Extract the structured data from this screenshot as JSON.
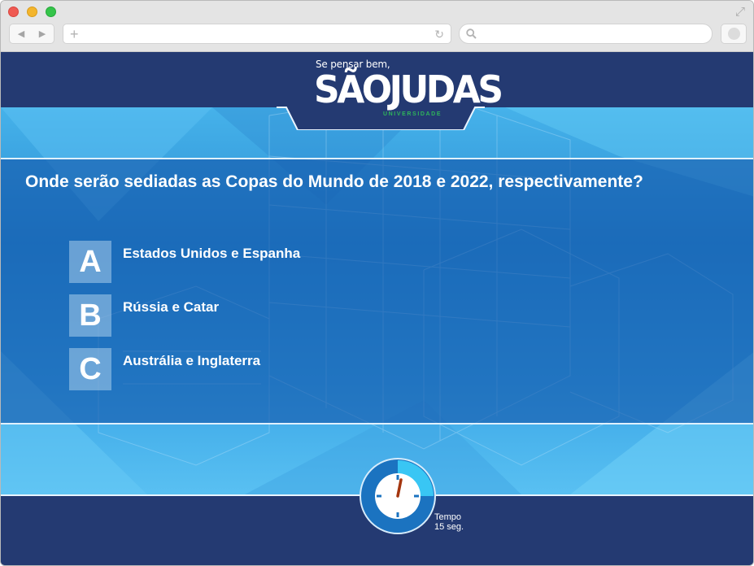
{
  "browser": {
    "nav_back": "◀",
    "nav_forward": "▶",
    "new_tab": "+",
    "reload": "↻",
    "expand": "⤢"
  },
  "brand": {
    "tagline": "Se pensar bem,",
    "name": "SÃOJUDAS",
    "subtitle": "UNIVERSIDADE"
  },
  "quiz": {
    "question": "Onde serão sediadas as Copas do Mundo de 2018 e 2022, respectivamente?",
    "options": [
      {
        "letter": "A",
        "text": "Estados Unidos e Espanha"
      },
      {
        "letter": "B",
        "text": "Rússia e Catar"
      },
      {
        "letter": "C",
        "text": "Austrália e Inglaterra"
      }
    ]
  },
  "timer": {
    "label": "Tempo",
    "value": "15 seg.",
    "remaining_fraction": 0.25
  },
  "colors": {
    "header": "#243a72",
    "panel": "#1256aa",
    "accent_green": "#2fb55a",
    "timer_ring": "#1b73c0",
    "timer_progress": "#39c6f4",
    "timer_hand": "#a4360f"
  }
}
